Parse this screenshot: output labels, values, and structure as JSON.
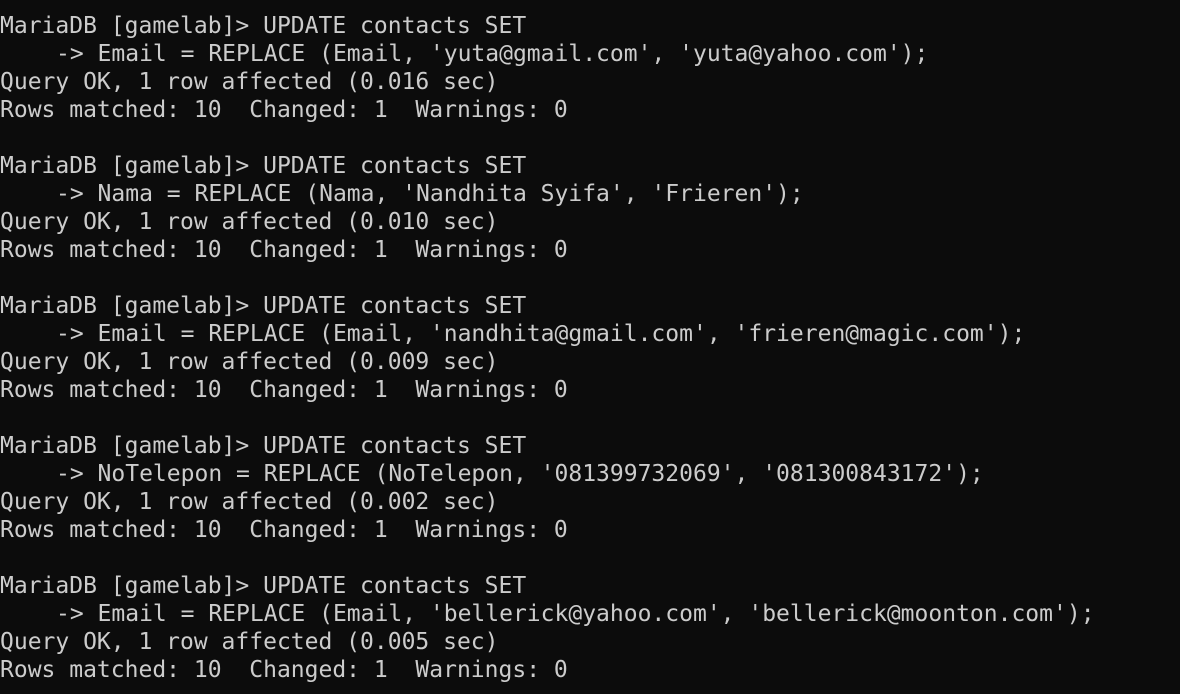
{
  "colors": {
    "background": "#0c0c0c",
    "text": "#cccccc"
  },
  "blocks": [
    {
      "command": "MariaDB [gamelab]> UPDATE contacts SET",
      "continuation": "-> Email = REPLACE (Email, 'yuta@gmail.com', 'yuta@yahoo.com');",
      "result": "Query OK, 1 row affected (0.016 sec)",
      "status": "Rows matched: 10  Changed: 1  Warnings: 0"
    },
    {
      "command": "MariaDB [gamelab]> UPDATE contacts SET",
      "continuation": "-> Nama = REPLACE (Nama, 'Nandhita Syifa', 'Frieren');",
      "result": "Query OK, 1 row affected (0.010 sec)",
      "status": "Rows matched: 10  Changed: 1  Warnings: 0"
    },
    {
      "command": "MariaDB [gamelab]> UPDATE contacts SET",
      "continuation": "-> Email = REPLACE (Email, 'nandhita@gmail.com', 'frieren@magic.com');",
      "result": "Query OK, 1 row affected (0.009 sec)",
      "status": "Rows matched: 10  Changed: 1  Warnings: 0"
    },
    {
      "command": "MariaDB [gamelab]> UPDATE contacts SET",
      "continuation": "-> NoTelepon = REPLACE (NoTelepon, '081399732069', '081300843172');",
      "result": "Query OK, 1 row affected (0.002 sec)",
      "status": "Rows matched: 10  Changed: 1  Warnings: 0"
    },
    {
      "command": "MariaDB [gamelab]> UPDATE contacts SET",
      "continuation": "-> Email = REPLACE (Email, 'bellerick@yahoo.com', 'bellerick@moonton.com');",
      "result": "Query OK, 1 row affected (0.005 sec)",
      "status": "Rows matched: 10  Changed: 1  Warnings: 0"
    }
  ]
}
